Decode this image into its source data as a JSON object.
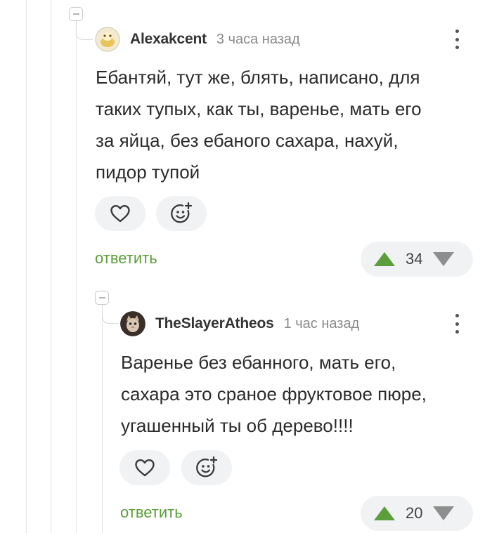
{
  "comments": [
    {
      "author": "Alexakcent",
      "time": "3 часа назад",
      "text_lines": [
        "Ебантяй, тут же, блять, написано, для",
        "таких тупых, как ты, варенье, мать его",
        "за яйца, без ебаного сахара, нахуй,",
        "пидор тупой"
      ],
      "reply_label": "ответить",
      "rating": "34"
    },
    {
      "author": "TheSlayerAtheos",
      "time": "1 час назад",
      "text_lines": [
        "Варенье без ебанного, мать его,",
        "сахара это сраное фруктовое пюре,",
        "угашенный ты об дерево!!!!"
      ],
      "reply_label": "ответить",
      "rating": "20"
    }
  ],
  "icons": {
    "like": "heart-icon",
    "react": "smiley-add-icon",
    "upvote": "triangle-up-icon",
    "downvote": "triangle-down-icon",
    "menu": "vertical-dots-icon",
    "collapse": "minus-box-icon"
  },
  "colors": {
    "reply_link": "#5c9e3a",
    "upvote": "#5c9e3a",
    "downvote": "#8e8e8e",
    "pill_bg": "#f1f2f4"
  }
}
